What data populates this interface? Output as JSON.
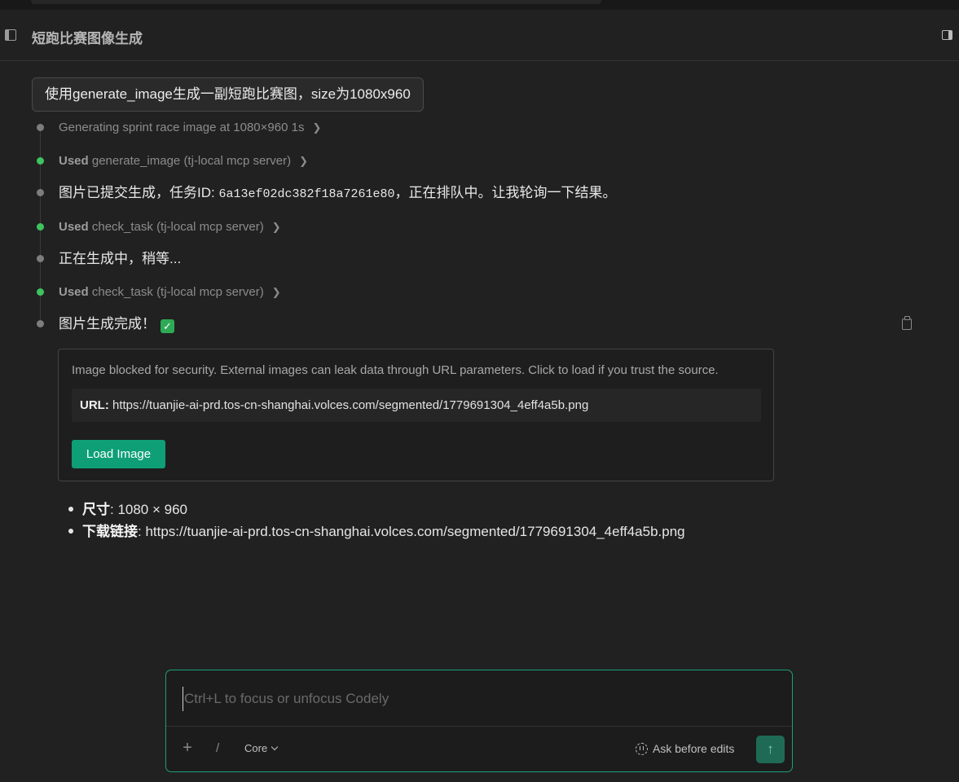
{
  "header": {
    "title": "短跑比赛图像生成"
  },
  "conversation": {
    "user_message": "使用generate_image生成一副短跑比赛图，size为1080x960",
    "steps": [
      {
        "type": "status",
        "text": "Generating sprint race image at 1080×960 1s",
        "status": "done"
      },
      {
        "type": "tool",
        "used_label": "Used",
        "tool": "generate_image (tj-local mcp server)",
        "status": "success"
      },
      {
        "type": "message",
        "text_prefix": "图片已提交生成，任务ID: ",
        "task_id": "6a13ef02dc382f18a7261e80",
        "text_suffix": "，正在排队中。让我轮询一下结果。"
      },
      {
        "type": "tool",
        "used_label": "Used",
        "tool": "check_task (tj-local mcp server)",
        "status": "success"
      },
      {
        "type": "message",
        "text": "正在生成中，稍等..."
      },
      {
        "type": "tool",
        "used_label": "Used",
        "tool": "check_task (tj-local mcp server)",
        "status": "success"
      },
      {
        "type": "message",
        "text": "图片生成完成！",
        "check": "✓"
      }
    ]
  },
  "blocked_image": {
    "note": "Image blocked for security. External images can leak data through URL parameters. Click to load if you trust the source.",
    "url_label": "URL:",
    "url": "https://tuanjie-ai-prd.tos-cn-shanghai.volces.com/segmented/1779691304_4eff4a5b.png",
    "button_label": "Load Image"
  },
  "info": {
    "size_label": "尺寸",
    "size_value": ": 1080 × 960",
    "link_label": "下载链接",
    "link_value": ": https://tuanjie-ai-prd.tos-cn-shanghai.volces.com/segmented/1779691304_4eff4a5b.png"
  },
  "composer": {
    "placeholder": "Ctrl+L to focus or unfocus Codely",
    "value": "",
    "plus": "+",
    "slash": "/",
    "model": "Core",
    "mode": "Ask before edits",
    "send_icon": "↑"
  },
  "colors": {
    "background": "#212121",
    "accent": "#1d9f7b",
    "button": "#0e9f77",
    "success_dot": "#3ec35f"
  },
  "icons": [
    "sidebar-left-icon",
    "sidebar-right-icon",
    "chevron-right-icon",
    "check-icon",
    "clipboard-icon",
    "plus-icon",
    "chevron-down-icon",
    "ask-mode-icon",
    "arrow-up-icon"
  ]
}
